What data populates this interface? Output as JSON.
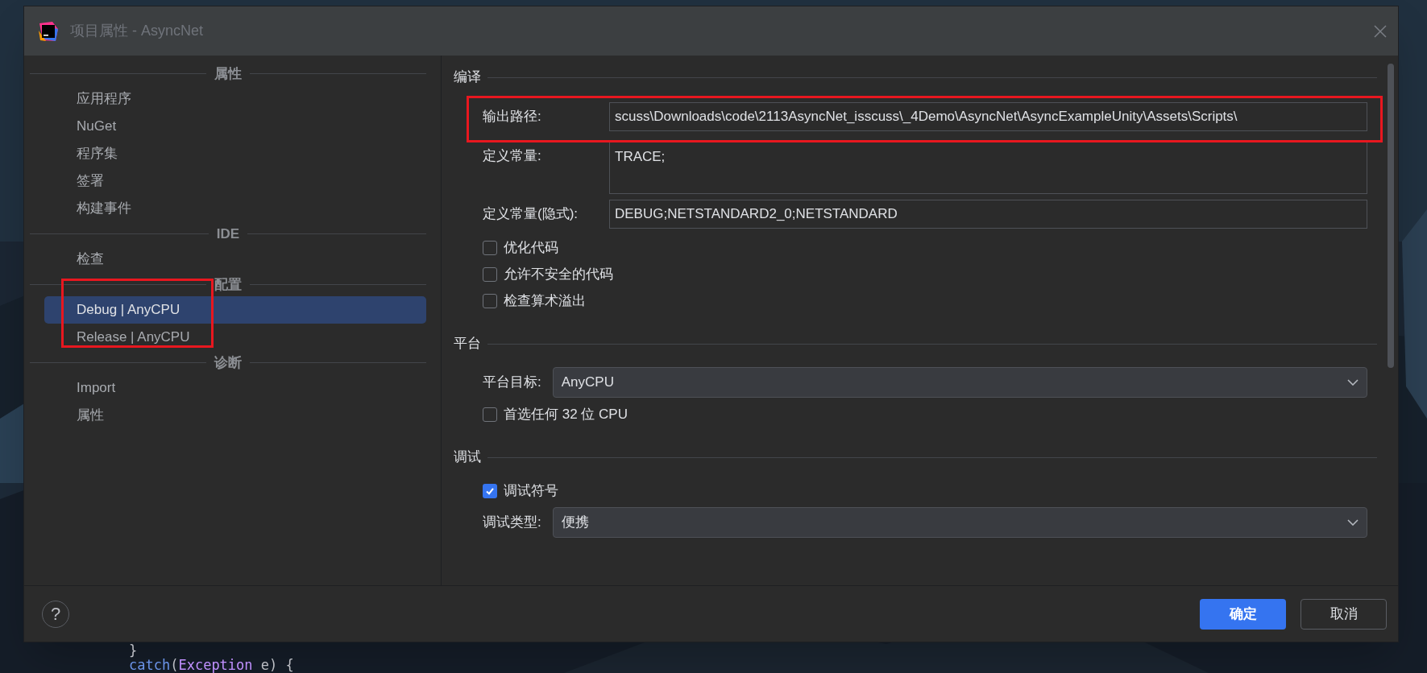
{
  "window": {
    "title": "项目属性 - AsyncNet"
  },
  "sidebar": {
    "groups": [
      {
        "header": "属性",
        "items": [
          {
            "label": "应用程序",
            "selected": false
          },
          {
            "label": "NuGet",
            "selected": false
          },
          {
            "label": "程序集",
            "selected": false
          },
          {
            "label": "签署",
            "selected": false
          },
          {
            "label": "构建事件",
            "selected": false
          }
        ]
      },
      {
        "header": "IDE",
        "items": [
          {
            "label": "检查",
            "selected": false
          }
        ]
      },
      {
        "header": "配置",
        "items": [
          {
            "label": "Debug | AnyCPU",
            "selected": true
          },
          {
            "label": "Release | AnyCPU",
            "selected": false
          }
        ]
      },
      {
        "header": "诊断",
        "items": [
          {
            "label": "Import",
            "selected": false
          },
          {
            "label": "属性",
            "selected": false
          }
        ]
      }
    ]
  },
  "sections": [
    {
      "kind": "aligned",
      "header": "编译",
      "rows": [
        {
          "kind": "input",
          "label": "输出路径:",
          "value": "scuss\\Downloads\\code\\2113AsyncNet_isscuss\\_4Demo\\AsyncNet\\AsyncExampleUnity\\Assets\\Scripts\\"
        },
        {
          "kind": "textarea",
          "label": "定义常量:",
          "value": "TRACE;"
        },
        {
          "kind": "input",
          "label": "定义常量(隐式):",
          "value": "DEBUG;NETSTANDARD2_0;NETSTANDARD"
        },
        {
          "kind": "checkbox",
          "label": "优化代码",
          "checked": false
        },
        {
          "kind": "checkbox",
          "label": "允许不安全的代码",
          "checked": false
        },
        {
          "kind": "checkbox",
          "label": "检查算术溢出",
          "checked": false
        }
      ]
    },
    {
      "kind": "compact",
      "header": "平台",
      "rows": [
        {
          "kind": "select",
          "label": "平台目标:",
          "value": "AnyCPU"
        },
        {
          "kind": "checkbox",
          "label": "首选任何 32 位 CPU",
          "checked": false
        }
      ]
    },
    {
      "kind": "compact",
      "header": "调试",
      "rows": [
        {
          "kind": "checkbox",
          "label": "调试符号",
          "checked": true
        },
        {
          "kind": "select",
          "label": "调试类型:",
          "value": "便携"
        }
      ]
    }
  ],
  "footer": {
    "help": "?",
    "buttons": [
      {
        "label": "确定",
        "kind": "primary"
      },
      {
        "label": "取消",
        "kind": "secondary"
      }
    ]
  },
  "editor": {
    "lines": [
      {
        "tokens": [
          {
            "text": "}",
            "kind": "plain"
          }
        ]
      },
      {
        "tokens": [
          {
            "text": "catch",
            "kind": "keyword"
          },
          {
            "text": "(",
            "kind": "plain"
          },
          {
            "text": "Exception",
            "kind": "type"
          },
          {
            "text": " e) {",
            "kind": "plain"
          }
        ]
      }
    ]
  }
}
